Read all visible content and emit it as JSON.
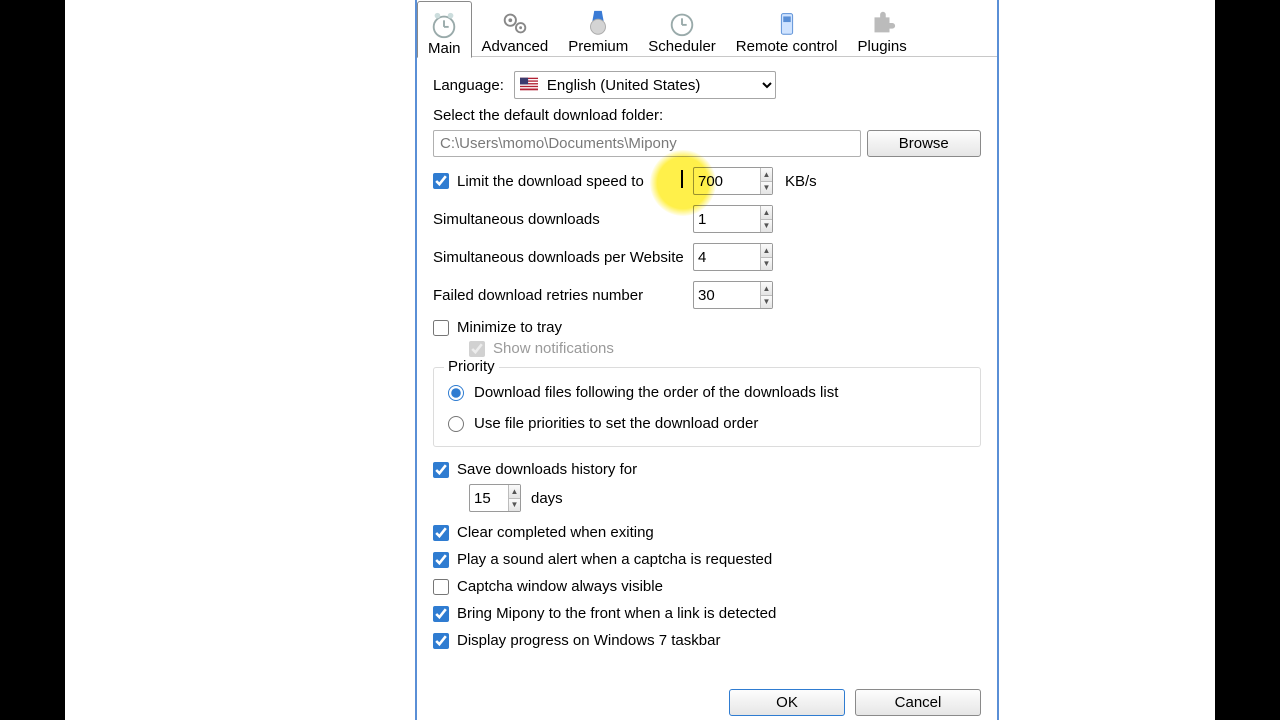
{
  "tabs": {
    "main": "Main",
    "advanced": "Advanced",
    "premium": "Premium",
    "scheduler": "Scheduler",
    "remote": "Remote control",
    "plugins": "Plugins"
  },
  "language": {
    "label": "Language:",
    "value": "English (United States)"
  },
  "folder": {
    "label": "Select the default download folder:",
    "value": "C:\\Users\\momo\\Documents\\Mipony",
    "browse": "Browse"
  },
  "limit": {
    "label": "Limit the download speed to",
    "value": "700",
    "unit": "KB/s",
    "checked": true
  },
  "sim_downloads": {
    "label": "Simultaneous downloads",
    "value": "1"
  },
  "sim_per_site": {
    "label": "Simultaneous downloads per Website",
    "value": "4"
  },
  "retries": {
    "label": "Failed download retries number",
    "value": "30"
  },
  "minimize": {
    "label": "Minimize to tray",
    "checked": false
  },
  "notifications": {
    "label": "Show notifications",
    "checked": true
  },
  "priority": {
    "legend": "Priority",
    "opt1": "Download files following the order of the downloads list",
    "opt2": "Use file priorities to set the download order"
  },
  "history": {
    "label": "Save downloads history for",
    "value": "15",
    "unit": "days",
    "checked": true
  },
  "clear_completed": {
    "label": "Clear completed when exiting",
    "checked": true
  },
  "sound_alert": {
    "label": "Play a sound alert when a captcha is requested",
    "checked": true
  },
  "captcha_visible": {
    "label": "Captcha window always visible",
    "checked": false
  },
  "bring_front": {
    "label": "Bring Mipony to the front when a link is detected",
    "checked": true
  },
  "taskbar": {
    "label": "Display progress on Windows 7 taskbar",
    "checked": true
  },
  "buttons": {
    "ok": "OK",
    "cancel": "Cancel"
  }
}
